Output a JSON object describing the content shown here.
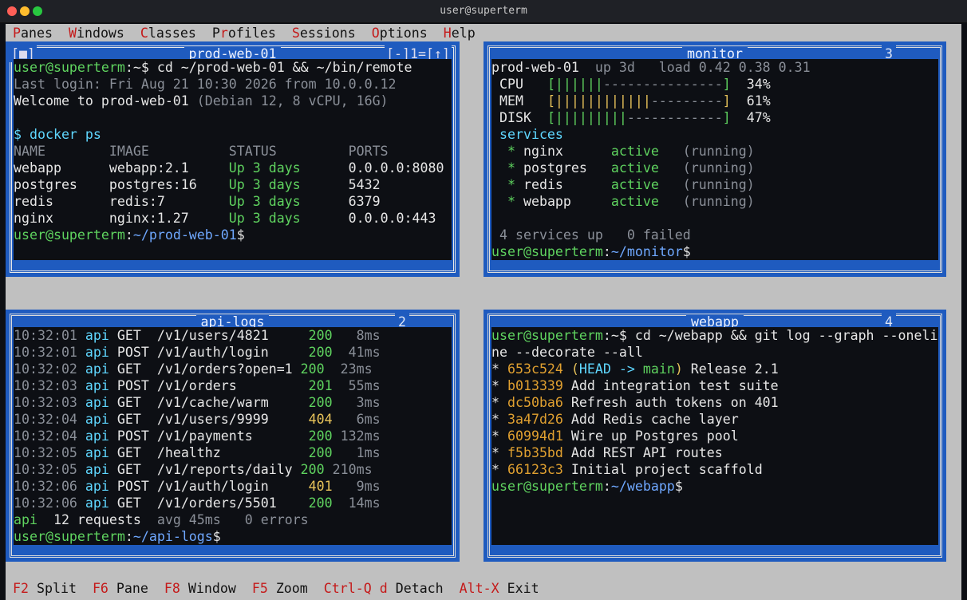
{
  "window": {
    "title": "user@superterm",
    "traffic_lights": [
      "#ff5f57",
      "#febc2e",
      "#28c840"
    ]
  },
  "menu": [
    {
      "hotkey": "P",
      "rest": "anes"
    },
    {
      "hotkey": "W",
      "rest": "indows"
    },
    {
      "hotkey": "C",
      "rest": "lasses"
    },
    {
      "prefix": "P",
      "hotkey": "r",
      "rest": "ofiles"
    },
    {
      "hotkey": "S",
      "rest": "essions"
    },
    {
      "hotkey": "O",
      "rest": "ptions"
    },
    {
      "hotkey": "H",
      "rest": "elp"
    }
  ],
  "colors": {
    "green": "#5fd35f",
    "user": "#5fd35f",
    "path": "#6fa8ff",
    "gray": "#8a8f98",
    "cyan": "#5fd7ff",
    "yellow": "#e8c35a",
    "orange": "#e0a030",
    "white": "#e6e6e6",
    "red": "#c41a1a",
    "blue_frame": "#1f5bbf"
  },
  "panes": [
    {
      "id": "pane-1",
      "title": "prod-web-01",
      "number": "1",
      "controls_left": "[■]",
      "controls_right": "[-]1=[↑]",
      "lines": [
        [
          {
            "t": "user@superterm",
            "c": "green"
          },
          {
            "t": ":~$ cd ~/prod-web-01 && ~/bin/remote",
            "c": "white"
          }
        ],
        [
          {
            "t": "Last login: Fri Aug 21 10:30 2026 from 10.0.0.12",
            "c": "gray"
          }
        ],
        [
          {
            "t": "Welcome to prod-web-01 ",
            "c": "white"
          },
          {
            "t": "(Debian 12, 8 vCPU, 16G)",
            "c": "gray"
          }
        ],
        [
          {
            "t": "",
            "c": "white"
          }
        ],
        [
          {
            "t": "$ docker ps",
            "c": "cyan"
          }
        ],
        [
          {
            "t": "NAME        IMAGE          STATUS         PORTS",
            "c": "gray"
          }
        ],
        [
          {
            "t": "webapp      webapp:2.1     ",
            "c": "white"
          },
          {
            "t": "Up 3 days",
            "c": "green"
          },
          {
            "t": "      0.0.0.0:8080",
            "c": "white"
          }
        ],
        [
          {
            "t": "postgres    postgres:16    ",
            "c": "white"
          },
          {
            "t": "Up 3 days",
            "c": "green"
          },
          {
            "t": "      5432",
            "c": "white"
          }
        ],
        [
          {
            "t": "redis       redis:7        ",
            "c": "white"
          },
          {
            "t": "Up 3 days",
            "c": "green"
          },
          {
            "t": "      6379",
            "c": "white"
          }
        ],
        [
          {
            "t": "nginx       nginx:1.27     ",
            "c": "white"
          },
          {
            "t": "Up 3 days",
            "c": "green"
          },
          {
            "t": "      0.0.0.0:443",
            "c": "white"
          }
        ],
        [
          {
            "t": "user@superterm",
            "c": "green"
          },
          {
            "t": ":",
            "c": "white"
          },
          {
            "t": "~/prod-web-01",
            "c": "path"
          },
          {
            "t": "$",
            "c": "white"
          }
        ]
      ]
    },
    {
      "id": "pane-3",
      "title": "monitor",
      "number": "3",
      "lines": [
        [
          {
            "t": "prod-web-01",
            "c": "white"
          },
          {
            "t": "  up 3d   load 0.42 0.38 0.31",
            "c": "gray"
          }
        ],
        [
          {
            "t": " CPU   ",
            "c": "white"
          },
          {
            "t": "[||||||",
            "c": "green"
          },
          {
            "t": "---------------",
            "c": "gray"
          },
          {
            "t": "]",
            "c": "green"
          },
          {
            "t": "  34%",
            "c": "white"
          }
        ],
        [
          {
            "t": " MEM   ",
            "c": "white"
          },
          {
            "t": "[||||||||||||",
            "c": "yellow"
          },
          {
            "t": "---------",
            "c": "gray"
          },
          {
            "t": "]",
            "c": "yellow"
          },
          {
            "t": "  61%",
            "c": "white"
          }
        ],
        [
          {
            "t": " DISK  ",
            "c": "white"
          },
          {
            "t": "[|||||||||",
            "c": "green"
          },
          {
            "t": "------------",
            "c": "gray"
          },
          {
            "t": "]",
            "c": "green"
          },
          {
            "t": "  47%",
            "c": "white"
          }
        ],
        [
          {
            "t": " services",
            "c": "cyan"
          }
        ],
        [
          {
            "t": "  * ",
            "c": "green"
          },
          {
            "t": "nginx      ",
            "c": "white"
          },
          {
            "t": "active",
            "c": "green"
          },
          {
            "t": "   (running)",
            "c": "gray"
          }
        ],
        [
          {
            "t": "  * ",
            "c": "green"
          },
          {
            "t": "postgres   ",
            "c": "white"
          },
          {
            "t": "active",
            "c": "green"
          },
          {
            "t": "   (running)",
            "c": "gray"
          }
        ],
        [
          {
            "t": "  * ",
            "c": "green"
          },
          {
            "t": "redis      ",
            "c": "white"
          },
          {
            "t": "active",
            "c": "green"
          },
          {
            "t": "   (running)",
            "c": "gray"
          }
        ],
        [
          {
            "t": "  * ",
            "c": "green"
          },
          {
            "t": "webapp     ",
            "c": "white"
          },
          {
            "t": "active",
            "c": "green"
          },
          {
            "t": "   (running)",
            "c": "gray"
          }
        ],
        [
          {
            "t": "",
            "c": "white"
          }
        ],
        [
          {
            "t": " 4 services up   0 failed",
            "c": "gray"
          }
        ],
        [
          {
            "t": "user@superterm",
            "c": "green"
          },
          {
            "t": ":",
            "c": "white"
          },
          {
            "t": "~/monitor",
            "c": "path"
          },
          {
            "t": "$",
            "c": "white"
          }
        ]
      ]
    },
    {
      "id": "pane-2",
      "title": "api-logs",
      "number": "2",
      "lines": [
        [
          {
            "t": "10:32:01 ",
            "c": "gray"
          },
          {
            "t": "api ",
            "c": "cyan"
          },
          {
            "t": "GET  /v1/users/4821     ",
            "c": "white"
          },
          {
            "t": "200",
            "c": "green"
          },
          {
            "t": "   8ms",
            "c": "gray"
          }
        ],
        [
          {
            "t": "10:32:01 ",
            "c": "gray"
          },
          {
            "t": "api ",
            "c": "cyan"
          },
          {
            "t": "POST /v1/auth/login     ",
            "c": "white"
          },
          {
            "t": "200",
            "c": "green"
          },
          {
            "t": "  41ms",
            "c": "gray"
          }
        ],
        [
          {
            "t": "10:32:02 ",
            "c": "gray"
          },
          {
            "t": "api ",
            "c": "cyan"
          },
          {
            "t": "GET  /v1/orders?open=1 ",
            "c": "white"
          },
          {
            "t": "200",
            "c": "green"
          },
          {
            "t": "  23ms",
            "c": "gray"
          }
        ],
        [
          {
            "t": "10:32:03 ",
            "c": "gray"
          },
          {
            "t": "api ",
            "c": "cyan"
          },
          {
            "t": "POST /v1/orders         ",
            "c": "white"
          },
          {
            "t": "201",
            "c": "green"
          },
          {
            "t": "  55ms",
            "c": "gray"
          }
        ],
        [
          {
            "t": "10:32:03 ",
            "c": "gray"
          },
          {
            "t": "api ",
            "c": "cyan"
          },
          {
            "t": "GET  /v1/cache/warm     ",
            "c": "white"
          },
          {
            "t": "200",
            "c": "green"
          },
          {
            "t": "   3ms",
            "c": "gray"
          }
        ],
        [
          {
            "t": "10:32:04 ",
            "c": "gray"
          },
          {
            "t": "api ",
            "c": "cyan"
          },
          {
            "t": "GET  /v1/users/9999     ",
            "c": "white"
          },
          {
            "t": "404",
            "c": "yellow"
          },
          {
            "t": "   6ms",
            "c": "gray"
          }
        ],
        [
          {
            "t": "10:32:04 ",
            "c": "gray"
          },
          {
            "t": "api ",
            "c": "cyan"
          },
          {
            "t": "POST /v1/payments       ",
            "c": "white"
          },
          {
            "t": "200",
            "c": "green"
          },
          {
            "t": " 132ms",
            "c": "gray"
          }
        ],
        [
          {
            "t": "10:32:05 ",
            "c": "gray"
          },
          {
            "t": "api ",
            "c": "cyan"
          },
          {
            "t": "GET  /healthz           ",
            "c": "white"
          },
          {
            "t": "200",
            "c": "green"
          },
          {
            "t": "   1ms",
            "c": "gray"
          }
        ],
        [
          {
            "t": "10:32:05 ",
            "c": "gray"
          },
          {
            "t": "api ",
            "c": "cyan"
          },
          {
            "t": "GET  /v1/reports/daily ",
            "c": "white"
          },
          {
            "t": "200",
            "c": "green"
          },
          {
            "t": " 210ms",
            "c": "gray"
          }
        ],
        [
          {
            "t": "10:32:06 ",
            "c": "gray"
          },
          {
            "t": "api ",
            "c": "cyan"
          },
          {
            "t": "POST /v1/auth/login     ",
            "c": "white"
          },
          {
            "t": "401",
            "c": "yellow"
          },
          {
            "t": "   9ms",
            "c": "gray"
          }
        ],
        [
          {
            "t": "10:32:06 ",
            "c": "gray"
          },
          {
            "t": "api ",
            "c": "cyan"
          },
          {
            "t": "GET  /v1/orders/5501    ",
            "c": "white"
          },
          {
            "t": "200",
            "c": "green"
          },
          {
            "t": "  14ms",
            "c": "gray"
          }
        ],
        [
          {
            "t": "api",
            "c": "green"
          },
          {
            "t": "  12 requests  ",
            "c": "white"
          },
          {
            "t": "avg 45ms   0 errors",
            "c": "gray"
          }
        ],
        [
          {
            "t": "user@superterm",
            "c": "green"
          },
          {
            "t": ":",
            "c": "white"
          },
          {
            "t": "~/api-logs",
            "c": "path"
          },
          {
            "t": "$",
            "c": "white"
          }
        ]
      ]
    },
    {
      "id": "pane-4",
      "title": "webapp",
      "number": "4",
      "lines": [
        [
          {
            "t": "user@superterm",
            "c": "green"
          },
          {
            "t": ":~$ cd ~/webapp && git log --graph --oneli",
            "c": "white"
          }
        ],
        [
          {
            "t": "ne --decorate --all",
            "c": "white"
          }
        ],
        [
          {
            "t": "* ",
            "c": "white"
          },
          {
            "t": "653c524",
            "c": "orange"
          },
          {
            "t": " (",
            "c": "yellow"
          },
          {
            "t": "HEAD -> ",
            "c": "cyan"
          },
          {
            "t": "main",
            "c": "green"
          },
          {
            "t": ")",
            "c": "yellow"
          },
          {
            "t": " Release 2.1",
            "c": "white"
          }
        ],
        [
          {
            "t": "* ",
            "c": "white"
          },
          {
            "t": "b013339",
            "c": "orange"
          },
          {
            "t": " Add integration test suite",
            "c": "white"
          }
        ],
        [
          {
            "t": "* ",
            "c": "white"
          },
          {
            "t": "dc50ba6",
            "c": "orange"
          },
          {
            "t": " Refresh auth tokens on 401",
            "c": "white"
          }
        ],
        [
          {
            "t": "* ",
            "c": "white"
          },
          {
            "t": "3a47d26",
            "c": "orange"
          },
          {
            "t": " Add Redis cache layer",
            "c": "white"
          }
        ],
        [
          {
            "t": "* ",
            "c": "white"
          },
          {
            "t": "60994d1",
            "c": "orange"
          },
          {
            "t": " Wire up Postgres pool",
            "c": "white"
          }
        ],
        [
          {
            "t": "* ",
            "c": "white"
          },
          {
            "t": "f5b35bd",
            "c": "orange"
          },
          {
            "t": " Add REST API routes",
            "c": "white"
          }
        ],
        [
          {
            "t": "* ",
            "c": "white"
          },
          {
            "t": "66123c3",
            "c": "orange"
          },
          {
            "t": " Initial project scaffold",
            "c": "white"
          }
        ],
        [
          {
            "t": "user@superterm",
            "c": "green"
          },
          {
            "t": ":",
            "c": "white"
          },
          {
            "t": "~/webapp",
            "c": "path"
          },
          {
            "t": "$",
            "c": "white"
          }
        ]
      ]
    }
  ],
  "statusbar": [
    {
      "key": "F2",
      "desc": "Split"
    },
    {
      "key": "F6",
      "desc": "Pane"
    },
    {
      "key": "F8",
      "desc": "Window"
    },
    {
      "key": "F5",
      "desc": "Zoom"
    },
    {
      "key": "Ctrl-Q d",
      "desc": "Detach"
    },
    {
      "key": "Alt-X",
      "desc": "Exit"
    }
  ]
}
